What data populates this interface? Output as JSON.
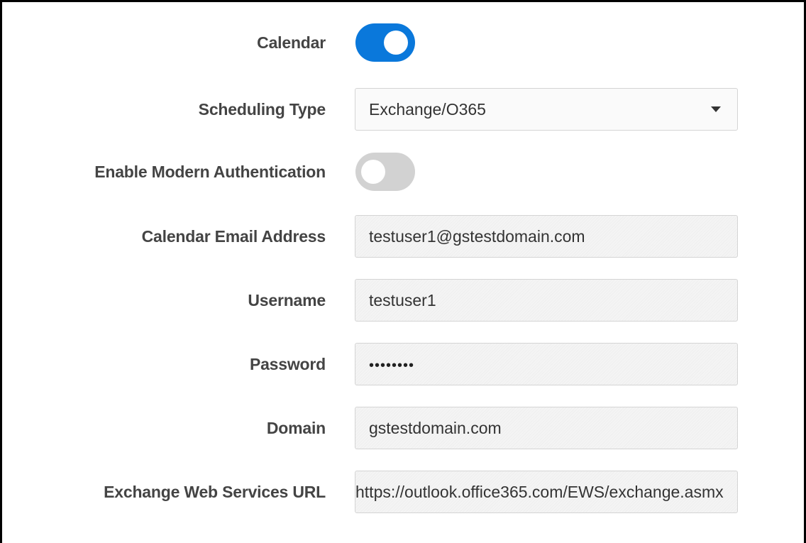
{
  "form": {
    "calendar": {
      "label": "Calendar",
      "enabled": true,
      "color_on": "#0a78db"
    },
    "scheduling_type": {
      "label": "Scheduling Type",
      "selected": "Exchange/O365",
      "icon": "chevron-down-icon"
    },
    "modern_auth": {
      "label": "Enable Modern Authentication",
      "enabled": false,
      "color_off": "#d2d2d2"
    },
    "calendar_email": {
      "label": "Calendar Email Address",
      "value": "testuser1@gstestdomain.com"
    },
    "username": {
      "label": "Username",
      "value": "testuser1"
    },
    "password": {
      "label": "Password",
      "value": "••••••••"
    },
    "domain": {
      "label": "Domain",
      "value": "gstestdomain.com"
    },
    "ews_url": {
      "label": "Exchange Web Services URL",
      "value": "https://outlook.office365.com/EWS/exchange.asmx"
    }
  }
}
